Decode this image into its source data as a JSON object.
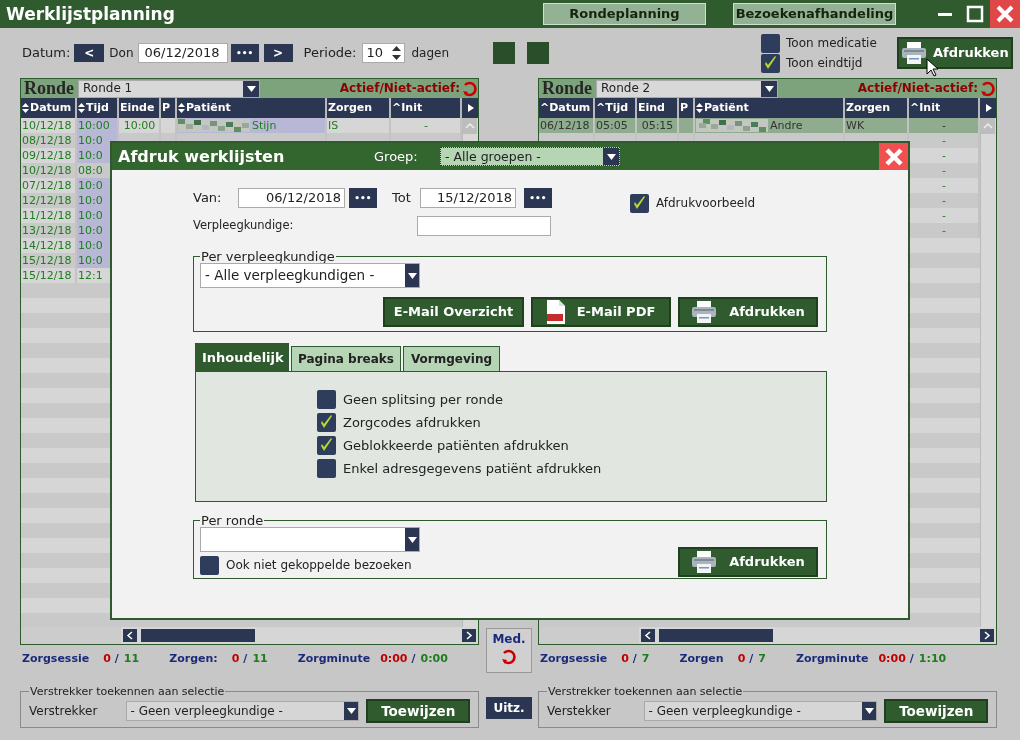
{
  "window": {
    "title": "Werklijstplanning",
    "nav_buttons": [
      {
        "label": "Rondeplanning"
      },
      {
        "label": "Bezoekenafhandeling"
      }
    ]
  },
  "toolbar": {
    "date_label": "Datum:",
    "prev": "<",
    "day": "Don",
    "date": "06/12/2018",
    "picker": "•••",
    "next": ">",
    "period_label": "Periode:",
    "period": "10",
    "period_unit": "dagen",
    "options": [
      {
        "label": "Toon medicatie",
        "checked": false
      },
      {
        "label": "Toon eindtijd",
        "checked": true
      }
    ],
    "print_button": "Afdrukken"
  },
  "panels": [
    {
      "title": "Ronde",
      "ronde": "Ronde 1",
      "active_label": "Actief/Niet-actief:",
      "columns": [
        {
          "label": "Datum",
          "sortable": true
        },
        {
          "label": "Tijd",
          "sortable": true
        },
        {
          "label": "Einde",
          "sortable": false
        },
        {
          "label": "P",
          "sortable": false
        },
        {
          "label": "Patiënt",
          "sortable": true
        },
        {
          "label": "Zorgen",
          "sortable": false
        },
        {
          "label": "^Init",
          "sortable": false
        }
      ],
      "rows": [
        {
          "datum": "10/12/18",
          "tijd": "10:00",
          "einde": "10:00",
          "patient": "Stijn",
          "zorgen": "IS",
          "init": "-",
          "highlighted": true,
          "selected": false
        },
        {
          "datum": "08/12/18",
          "tijd": "10:0",
          "highlighted": true,
          "selected": false
        },
        {
          "datum": "09/12/18",
          "tijd": "10:0",
          "highlighted": true,
          "selected": false
        },
        {
          "datum": "10/12/18",
          "tijd": "08:0",
          "highlighted": false,
          "selected": false
        },
        {
          "datum": "07/12/18",
          "tijd": "10:0",
          "highlighted": true,
          "selected": false
        },
        {
          "datum": "12/12/18",
          "tijd": "10:0",
          "highlighted": true,
          "selected": false
        },
        {
          "datum": "11/12/18",
          "tijd": "10:0",
          "highlighted": true,
          "selected": false
        },
        {
          "datum": "13/12/18",
          "tijd": "10:0",
          "highlighted": true,
          "selected": false
        },
        {
          "datum": "14/12/18",
          "tijd": "10:0",
          "highlighted": true,
          "selected": false
        },
        {
          "datum": "15/12/18",
          "tijd": "10:0",
          "highlighted": true,
          "selected": false
        },
        {
          "datum": "15/12/18",
          "tijd": "12:1",
          "highlighted": false,
          "selected": false
        }
      ],
      "summary": [
        {
          "label": "Zorgsessie",
          "done": "0",
          "sep": "/",
          "total": "11"
        },
        {
          "label": "Zorgen:",
          "done": "0",
          "sep": "/",
          "total": "11"
        },
        {
          "label": "Zorgminute",
          "done": "0:00",
          "sep": "/",
          "total": "0:00"
        }
      ],
      "assign": {
        "legend": "Verstrekker toekennen aan selectie",
        "label": "Verstrekker",
        "select": "- Geen verpleegkundige -",
        "button": "Toewijzen"
      }
    },
    {
      "title": "Ronde",
      "ronde": "Ronde 2",
      "active_label": "Actief/Niet-actief:",
      "columns": [
        {
          "label": "^Datum",
          "sortable": false
        },
        {
          "label": "^Tijd",
          "sortable": false
        },
        {
          "label": "Eind",
          "sortable": false
        },
        {
          "label": "P",
          "sortable": false
        },
        {
          "label": "Patiënt",
          "sortable": true
        },
        {
          "label": "Zorgen",
          "sortable": false
        },
        {
          "label": "^Init",
          "sortable": false
        }
      ],
      "rows": [
        {
          "datum": "06/12/18",
          "tijd": "05:05",
          "einde": "05:15",
          "patient": "Andre",
          "zorgen": "WK",
          "init": "-",
          "highlighted": false,
          "selected": true
        },
        {
          "init": "-",
          "selected": false
        },
        {
          "init": "-",
          "selected": false
        },
        {
          "init": "-",
          "selected": false
        },
        {
          "init": "-",
          "selected": false
        },
        {
          "init": "-",
          "selected": false
        },
        {
          "init": "-",
          "selected": false
        },
        {
          "init": "-",
          "selected": false
        }
      ],
      "summary": [
        {
          "label": "Zorgsessie",
          "done": "0",
          "sep": "/",
          "total": "7"
        },
        {
          "label": "Zorgen",
          "done": "0",
          "sep": "/",
          "total": "7"
        },
        {
          "label": "Zorgminute",
          "done": "0:00",
          "sep": "/",
          "total": "1:10"
        }
      ],
      "assign": {
        "legend": "Verstrekker toekennen aan selectie",
        "label": "Verstekker",
        "select": "- Geen verpleegkundige -",
        "button": "Toewijzen"
      }
    }
  ],
  "middle": {
    "med_button": "Med.",
    "uitz_button": "Uitz."
  },
  "dialog": {
    "title": "Afdruk werklijsten",
    "group_label": "Groep:",
    "group": "- Alle groepen -",
    "from_label": "Van:",
    "from": "06/12/2018",
    "from_picker": "•••",
    "to_label": "Tot",
    "to": "15/12/2018",
    "to_picker": "•••",
    "preview": {
      "label": "Afdrukvoorbeeld",
      "checked": true
    },
    "nurse_label": "Verpleegkundige:",
    "per_nurse": {
      "legend": "Per verpleegkundige",
      "select": "- Alle verpleegkundigen -",
      "buttons": [
        {
          "label": "E-Mail Overzicht"
        },
        {
          "label": "E-Mail PDF"
        },
        {
          "label": "Afdrukken"
        }
      ]
    },
    "tabs": [
      {
        "label": "Inhoudelijk",
        "selected": true
      },
      {
        "label": "Pagina breaks",
        "selected": false
      },
      {
        "label": "Vormgeving",
        "selected": false
      }
    ],
    "options": [
      {
        "label": "Geen splitsing per ronde",
        "checked": false
      },
      {
        "label": "Zorgcodes afdrukken",
        "checked": true
      },
      {
        "label": "Geblokkeerde patiënten afdrukken",
        "checked": true
      },
      {
        "label": "Enkel adresgegevens patiënt afdrukken",
        "checked": false
      }
    ],
    "per_round": {
      "legend": "Per ronde",
      "unlinked": {
        "label": "Ook niet gekoppelde bezoeken",
        "checked": false
      },
      "button": {
        "label": "Afdrukken"
      }
    }
  }
}
